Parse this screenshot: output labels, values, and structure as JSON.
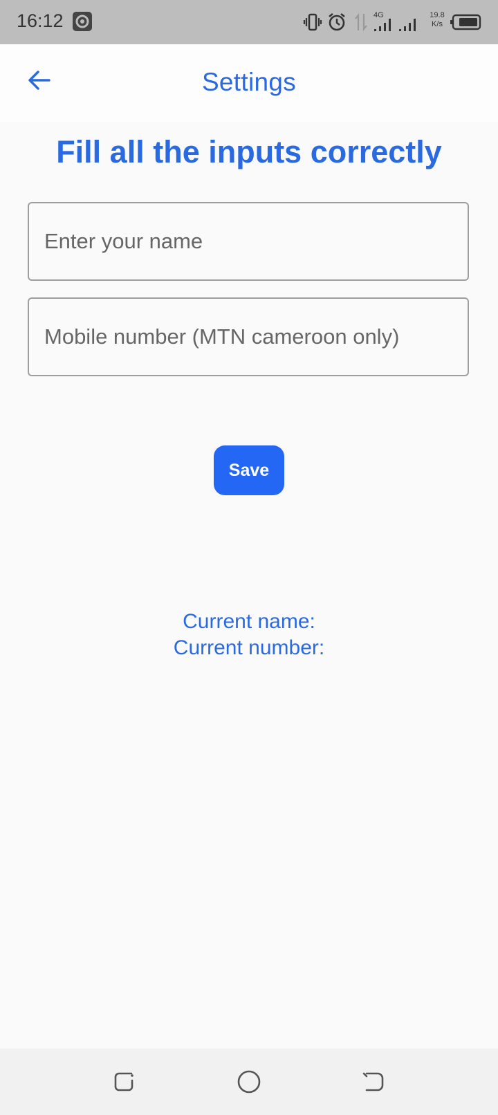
{
  "status_bar": {
    "time": "16:12",
    "network_label": "4G",
    "speed_value": "19.8",
    "speed_unit": "K/s",
    "icons": [
      "screenshot-icon",
      "vibrate-icon",
      "alarm-icon",
      "data-arrows-icon",
      "signal-icon",
      "signal-icon",
      "battery-icon"
    ]
  },
  "app_bar": {
    "title": "Settings",
    "back_icon": "arrow-left-icon"
  },
  "form": {
    "heading": "Fill all the inputs correctly",
    "name_field": {
      "value": "",
      "placeholder": "Enter your name"
    },
    "number_field": {
      "value": "",
      "placeholder": "Mobile number (MTN cameroon only)"
    },
    "save_label": "Save"
  },
  "current": {
    "name_label": "Current name:",
    "number_label": "Current number:"
  },
  "nav_bar": {
    "icons": [
      "recent-apps-icon",
      "home-icon",
      "back-icon"
    ]
  },
  "colors": {
    "accent": "#2a6ae0",
    "button": "#2567f5",
    "status_bar": "#bdbdbd",
    "nav_bar": "#f1f1f1"
  }
}
